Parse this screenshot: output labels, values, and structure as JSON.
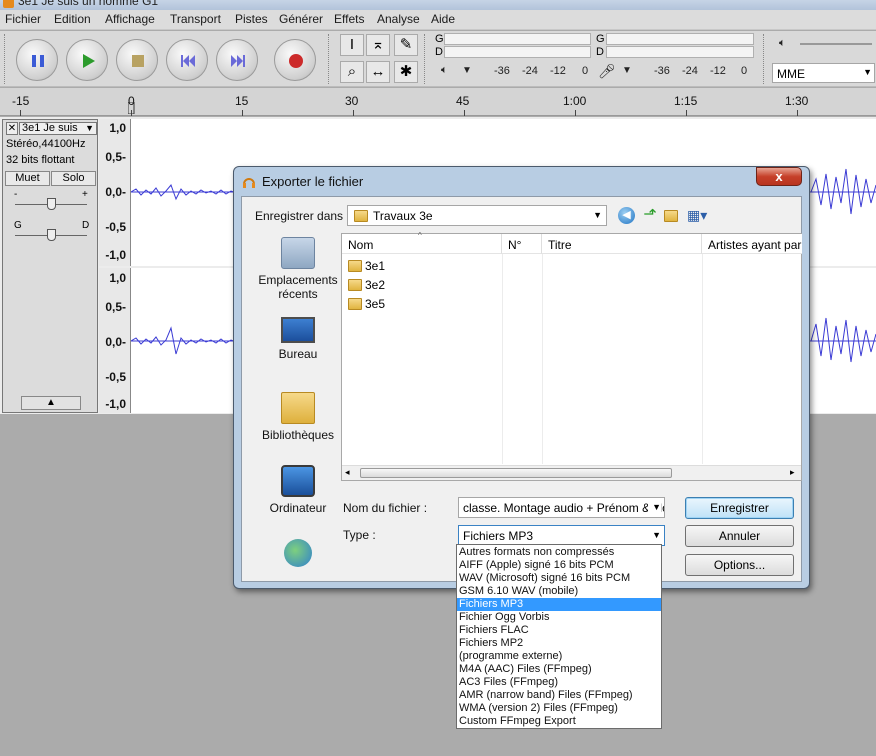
{
  "window": {
    "title": "3e1 Je suis un homme G1"
  },
  "menu": [
    "Fichier",
    "Edition",
    "Affichage",
    "Transport",
    "Pistes",
    "Générer",
    "Effets",
    "Analyse",
    "Aide"
  ],
  "meters": {
    "play_label_g": "G",
    "play_label_d": "D",
    "rec_label_g": "G",
    "rec_label_d": "D",
    "scale": [
      "-36",
      "-24",
      "-12",
      "0"
    ],
    "scale2": [
      "-36",
      "-24",
      "-12",
      "0"
    ],
    "device": "MME"
  },
  "ruler": [
    "-15",
    "0",
    "15",
    "30",
    "45",
    "1:00",
    "1:15",
    "1:30"
  ],
  "track": {
    "close": "✕",
    "name": "3e1 Je suis",
    "info1": "Stéréo,44100Hz",
    "info2": "32 bits flottant",
    "mute": "Muet",
    "solo": "Solo",
    "gain_minus": "-",
    "gain_plus": "+",
    "pan_left": "G",
    "pan_right": "D"
  },
  "vscale": [
    "1,0",
    "0,5-",
    "0,0-",
    "-0,5",
    "-1,0"
  ],
  "vscale2": [
    "1,0",
    "0,5-",
    "0,0-",
    "-0,5",
    "-1,0"
  ],
  "dialog": {
    "title": "Exporter le fichier",
    "close": "x",
    "save_in_label": "Enregistrer dans :",
    "save_in_value": "Travaux 3e",
    "places": [
      "Emplacements récents",
      "Bureau",
      "Bibliothèques",
      "Ordinateur",
      ""
    ],
    "columns": [
      "Nom",
      "N°",
      "Titre",
      "Artistes ayant par"
    ],
    "files": [
      "3e1",
      "3e2",
      "3e5"
    ],
    "filename_label": "Nom du fichier :",
    "filename_value": "classe. Montage audio + Prénom & Nom",
    "type_label": "Type :",
    "type_value": "Fichiers MP3",
    "save_btn": "Enregistrer",
    "cancel_btn": "Annuler",
    "options_btn": "Options..."
  },
  "type_options": [
    "Autres formats non compressés",
    "AIFF (Apple) signé 16 bits PCM",
    "WAV (Microsoft) signé 16 bits PCM",
    "GSM 6.10 WAV (mobile)",
    "Fichiers MP3",
    "Fichier Ogg Vorbis",
    "Fichiers FLAC",
    "Fichiers MP2",
    "(programme externe)",
    "M4A (AAC) Files (FFmpeg)",
    "AC3 Files (FFmpeg)",
    "AMR (narrow band) Files (FFmpeg)",
    "WMA (version 2) Files (FFmpeg)",
    "Custom FFmpeg Export"
  ],
  "selected_type_index": 4
}
